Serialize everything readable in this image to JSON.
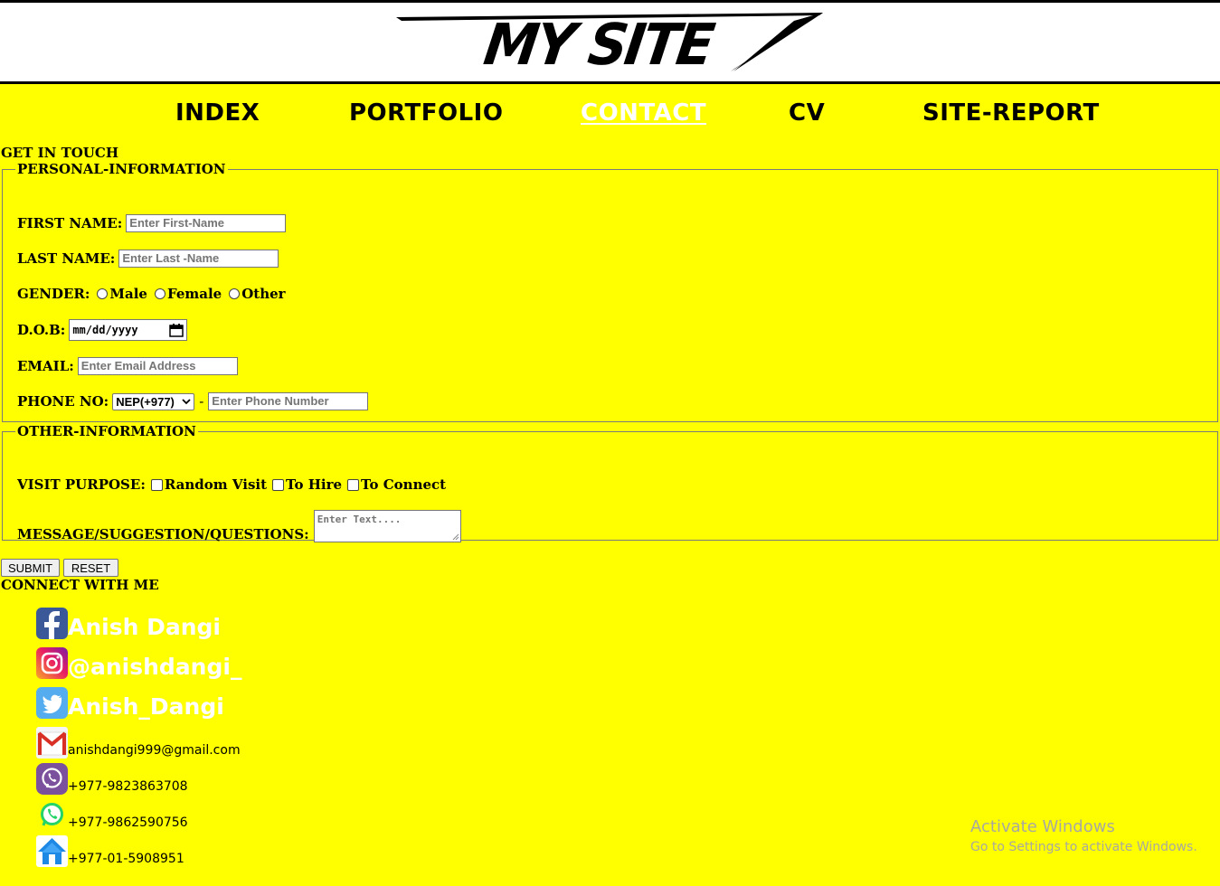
{
  "header": {
    "logo_text": "MY SITE"
  },
  "nav": [
    {
      "label": "INDEX",
      "active": false
    },
    {
      "label": "PORTFOLIO",
      "active": false
    },
    {
      "label": "CONTACT",
      "active": true
    },
    {
      "label": "CV",
      "active": false
    },
    {
      "label": "SITE-REPORT",
      "active": false
    }
  ],
  "page": {
    "heading": "GET IN TOUCH"
  },
  "personal": {
    "legend": "PERSONAL-INFORMATION",
    "first_name_label": "FIRST NAME:",
    "first_name_placeholder": "Enter First-Name",
    "last_name_label": "LAST NAME:",
    "last_name_placeholder": "Enter Last -Name",
    "gender_label": "GENDER:",
    "gender_options": [
      "Male",
      "Female",
      "Other"
    ],
    "dob_label": "D.O.B:",
    "dob_placeholder": "mm/dd/yyyy",
    "email_label": "EMAIL:",
    "email_placeholder": "Enter Email Address",
    "phone_label": "PHONE NO:",
    "phone_code": "NEP(+977)",
    "phone_separator": "-",
    "phone_placeholder": "Enter Phone Number"
  },
  "other": {
    "legend": "OTHER-INFORMATION",
    "purpose_label": "VISIT PURPOSE:",
    "purpose_options": [
      "Random Visit",
      "To Hire",
      "To Connect"
    ],
    "message_label": "MESSAGE/SUGGESTION/QUESTIONS:",
    "message_placeholder": "Enter Text...."
  },
  "buttons": {
    "submit": "SUBMIT",
    "reset": "RESET"
  },
  "connect": {
    "heading": "CONNECT WITH ME",
    "facebook": "Anish Dangi",
    "instagram": "@anishdangi_",
    "twitter": "Anish_Dangi",
    "email": "anishdangi999@gmail.com",
    "viber": "+977-9823863708",
    "whatsapp": "+977-9862590756",
    "home": "+977-01-5908951"
  },
  "watermark": {
    "title": "Activate Windows",
    "subtitle": "Go to Settings to activate Windows."
  },
  "colors": {
    "background": "#ffff00",
    "active_nav": "#ffffff"
  }
}
